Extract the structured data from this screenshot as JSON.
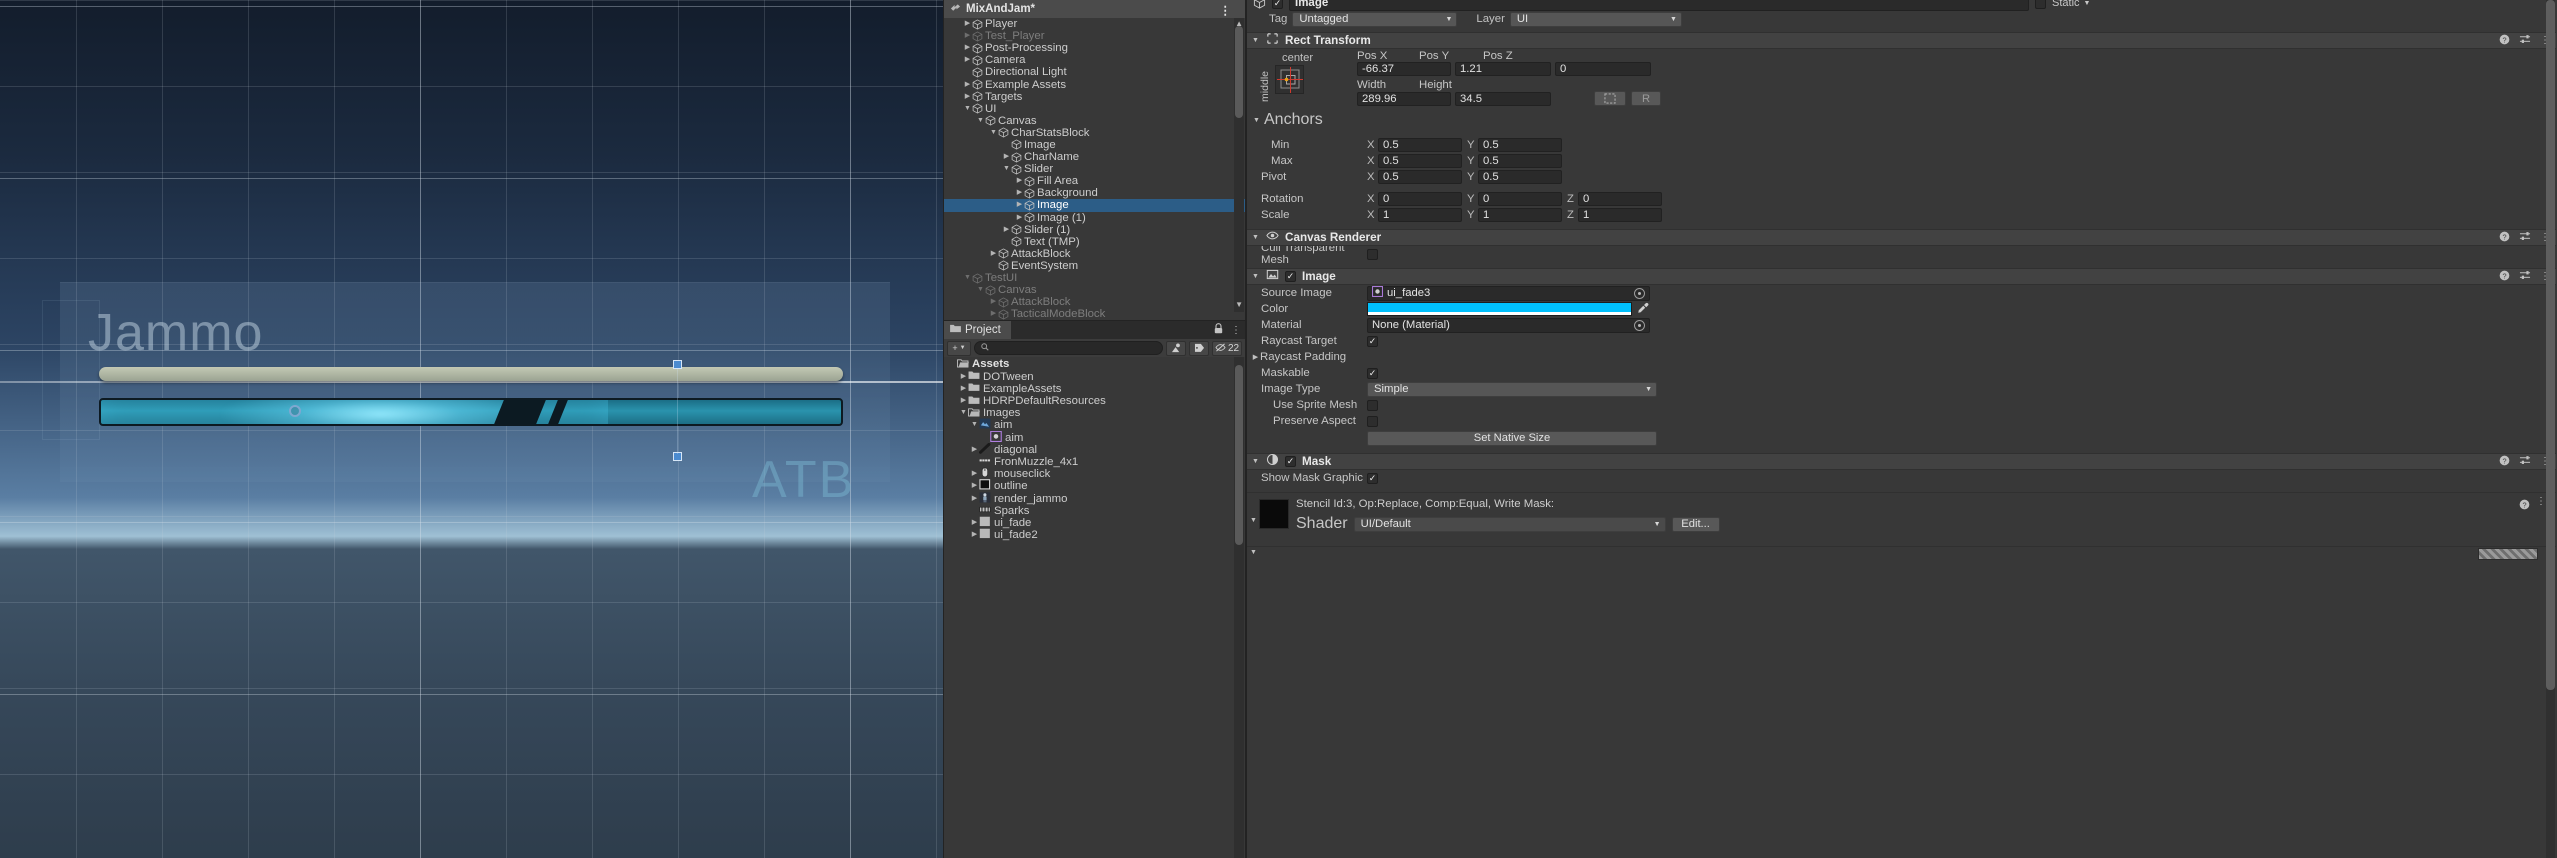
{
  "gameview": {
    "char_name": "Jammo",
    "atb_label": "ATB",
    "hp_value_pct": 100,
    "atb_value_pct": 68.5
  },
  "hierarchy": {
    "scene_name": "MixAndJam*",
    "kebab_icon": "kebab-menu-icon",
    "items": [
      {
        "label": "Player",
        "depth": 1,
        "twist": "right",
        "dim": false,
        "sel": false
      },
      {
        "label": "Test_Player",
        "depth": 1,
        "twist": "right",
        "dim": true,
        "sel": false
      },
      {
        "label": "Post-Processing",
        "depth": 1,
        "twist": "right",
        "dim": false,
        "sel": false
      },
      {
        "label": "Camera",
        "depth": 1,
        "twist": "right",
        "dim": false,
        "sel": false
      },
      {
        "label": "Directional Light",
        "depth": 1,
        "twist": "none",
        "dim": false,
        "sel": false
      },
      {
        "label": "Example Assets",
        "depth": 1,
        "twist": "right",
        "dim": false,
        "sel": false
      },
      {
        "label": "Targets",
        "depth": 1,
        "twist": "right",
        "dim": false,
        "sel": false
      },
      {
        "label": "UI",
        "depth": 1,
        "twist": "down",
        "dim": false,
        "sel": false
      },
      {
        "label": "Canvas",
        "depth": 2,
        "twist": "down",
        "dim": false,
        "sel": false
      },
      {
        "label": "CharStatsBlock",
        "depth": 3,
        "twist": "down",
        "dim": false,
        "sel": false
      },
      {
        "label": "Image",
        "depth": 4,
        "twist": "none",
        "dim": false,
        "sel": false
      },
      {
        "label": "CharName",
        "depth": 4,
        "twist": "right",
        "dim": false,
        "sel": false
      },
      {
        "label": "Slider",
        "depth": 4,
        "twist": "down",
        "dim": false,
        "sel": false
      },
      {
        "label": "Fill Area",
        "depth": 5,
        "twist": "right",
        "dim": false,
        "sel": false
      },
      {
        "label": "Background",
        "depth": 5,
        "twist": "right",
        "dim": false,
        "sel": false
      },
      {
        "label": "Image",
        "depth": 5,
        "twist": "right",
        "dim": false,
        "sel": true
      },
      {
        "label": "Image (1)",
        "depth": 5,
        "twist": "right",
        "dim": false,
        "sel": false
      },
      {
        "label": "Slider (1)",
        "depth": 4,
        "twist": "right",
        "dim": false,
        "sel": false
      },
      {
        "label": "Text (TMP)",
        "depth": 4,
        "twist": "none",
        "dim": false,
        "sel": false
      },
      {
        "label": "AttackBlock",
        "depth": 3,
        "twist": "right",
        "dim": false,
        "sel": false
      },
      {
        "label": "EventSystem",
        "depth": 3,
        "twist": "none",
        "dim": false,
        "sel": false
      },
      {
        "label": "TestUI",
        "depth": 1,
        "twist": "down",
        "dim": true,
        "sel": false
      },
      {
        "label": "Canvas",
        "depth": 2,
        "twist": "down",
        "dim": true,
        "sel": false
      },
      {
        "label": "AttackBlock",
        "depth": 3,
        "twist": "right",
        "dim": true,
        "sel": false
      },
      {
        "label": "TacticalModeBlock",
        "depth": 3,
        "twist": "right",
        "dim": true,
        "sel": false
      }
    ]
  },
  "project": {
    "tab_label": "Project",
    "lock_icon": "lock-icon",
    "kebab_icon": "kebab-menu-icon",
    "add_label": "+",
    "search_placeholder": "",
    "search_value": "",
    "search_icon": "search-icon",
    "filter_type_icon": "filter-by-type-icon",
    "filter_label_icon": "filter-by-label-icon",
    "hidden_count": "22",
    "hidden_icon": "hidden-items-icon",
    "items": [
      {
        "label": "Assets",
        "depth": 0,
        "twist": "none",
        "icon": "folder-open-icon",
        "bold": true
      },
      {
        "label": "DOTween",
        "depth": 1,
        "twist": "right",
        "icon": "folder-icon",
        "bold": false
      },
      {
        "label": "ExampleAssets",
        "depth": 1,
        "twist": "right",
        "icon": "folder-icon",
        "bold": false
      },
      {
        "label": "HDRPDefaultResources",
        "depth": 1,
        "twist": "right",
        "icon": "folder-icon",
        "bold": false
      },
      {
        "label": "Images",
        "depth": 1,
        "twist": "down",
        "icon": "folder-open-icon",
        "bold": false
      },
      {
        "label": "aim",
        "depth": 2,
        "twist": "down",
        "icon": "texture-icon",
        "bold": false
      },
      {
        "label": "aim",
        "depth": 3,
        "twist": "none",
        "icon": "sprite-icon",
        "bold": false
      },
      {
        "label": "diagonal",
        "depth": 2,
        "twist": "right",
        "icon": "texture-diagonal-icon",
        "bold": false
      },
      {
        "label": "FronMuzzle_4x1",
        "depth": 2,
        "twist": "none",
        "icon": "texture-strip-icon",
        "bold": false
      },
      {
        "label": "mouseclick",
        "depth": 2,
        "twist": "right",
        "icon": "texture-mouse-icon",
        "bold": false
      },
      {
        "label": "outline",
        "depth": 2,
        "twist": "right",
        "icon": "texture-outline-icon",
        "bold": false
      },
      {
        "label": "render_jammo",
        "depth": 2,
        "twist": "right",
        "icon": "texture-render-icon",
        "bold": false
      },
      {
        "label": "Sparks",
        "depth": 2,
        "twist": "none",
        "icon": "texture-sparks-icon",
        "bold": false
      },
      {
        "label": "ui_fade",
        "depth": 2,
        "twist": "right",
        "icon": "texture-gradient-icon",
        "bold": false
      },
      {
        "label": "ui_fade2",
        "depth": 2,
        "twist": "right",
        "icon": "texture-gradient-icon",
        "bold": false
      }
    ]
  },
  "inspector": {
    "object_active": true,
    "object_name": "Image",
    "static_label": "Static",
    "static_checked": false,
    "tag_label": "Tag",
    "tag_value": "Untagged",
    "layer_label": "Layer",
    "layer_value": "UI",
    "rect_transform": {
      "title": "Rect Transform",
      "anchor_preset_top": "center",
      "anchor_preset_side": "middle",
      "pos_x_label": "Pos X",
      "pos_y_label": "Pos Y",
      "pos_z_label": "Pos Z",
      "pos_x": "-66.37",
      "pos_y": "1.21",
      "pos_z": "0",
      "width_label": "Width",
      "height_label": "Height",
      "width": "289.96",
      "height": "34.5",
      "blueprint_icon": "blueprint-mode-icon",
      "raw_label": "R",
      "anchors_label": "Anchors",
      "min_label": "Min",
      "min_x": "0.5",
      "min_y": "0.5",
      "max_label": "Max",
      "max_x": "0.5",
      "max_y": "0.5",
      "pivot_label": "Pivot",
      "pivot_x": "0.5",
      "pivot_y": "0.5",
      "rotation_label": "Rotation",
      "rot_x": "0",
      "rot_y": "0",
      "rot_z": "0",
      "scale_label": "Scale",
      "scale_x": "1",
      "scale_y": "1",
      "scale_z": "1"
    },
    "canvas_renderer": {
      "title": "Canvas Renderer",
      "cull_label": "Cull Transparent Mesh",
      "cull_checked": false
    },
    "image": {
      "title": "Image",
      "enabled": true,
      "source_image_label": "Source Image",
      "source_image_value": "ui_fade3",
      "color_label": "Color",
      "color_value": "#00C0FC",
      "color_picker_icon": "eyedropper-icon",
      "material_label": "Material",
      "material_value": "None (Material)",
      "raycast_target_label": "Raycast Target",
      "raycast_target_checked": true,
      "raycast_padding_label": "Raycast Padding",
      "maskable_label": "Maskable",
      "maskable_checked": true,
      "image_type_label": "Image Type",
      "image_type_value": "Simple",
      "use_sprite_mesh_label": "Use Sprite Mesh",
      "use_sprite_mesh_checked": false,
      "preserve_aspect_label": "Preserve Aspect",
      "preserve_aspect_checked": false,
      "set_native_size_label": "Set Native Size"
    },
    "mask": {
      "title": "Mask",
      "enabled": true,
      "show_mask_graphic_label": "Show Mask Graphic",
      "show_mask_graphic_checked": true
    },
    "material": {
      "title": "Stencil Id:3, Op:Replace, Comp:Equal, Write Mask:",
      "shader_label": "Shader",
      "shader_value": "UI/Default",
      "edit_label": "Edit..."
    },
    "help_icon": "help-icon",
    "preset_icon": "preset-icon",
    "kebab_icon": "kebab-menu-icon"
  }
}
